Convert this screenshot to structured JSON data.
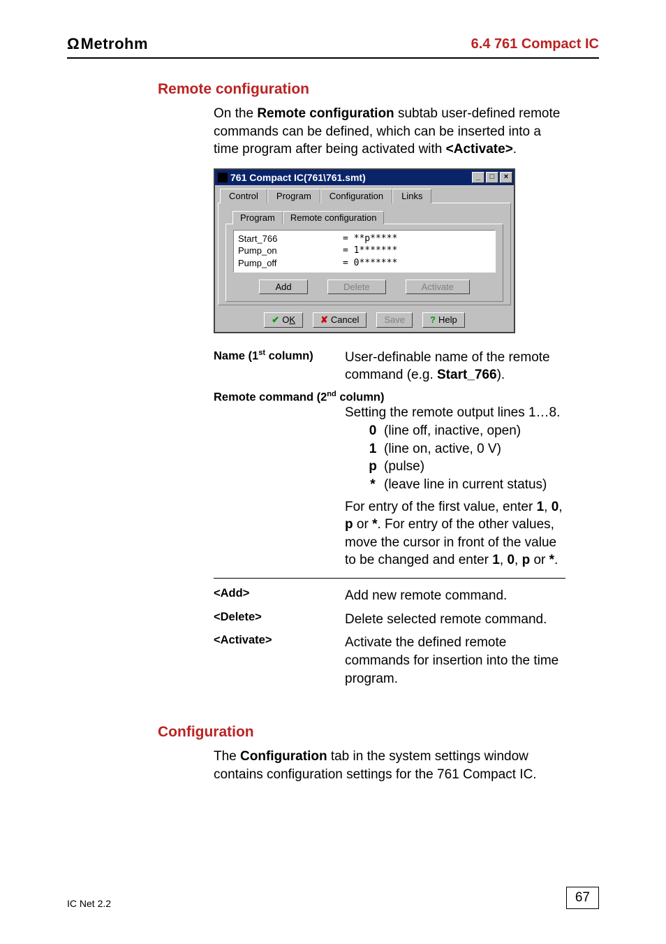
{
  "header": {
    "logo_text": "Metrohm",
    "section": "6.4  761 Compact IC"
  },
  "s1": {
    "title": "Remote configuration",
    "intro_pre": "On the ",
    "intro_bold": "Remote configuration",
    "intro_mid": " subtab user-defined remote commands can be defined, which can be inserted into a time program after being activated with ",
    "intro_activate": "<Activate>",
    "intro_end": "."
  },
  "dialog": {
    "title": "761 Compact IC(761\\761.smt)",
    "tabs": {
      "t0": "Control",
      "t1": "Program",
      "t2": "Configuration",
      "t3": "Links"
    },
    "subtabs": {
      "s0": "Program",
      "s1": "Remote configuration"
    },
    "rows": [
      {
        "name": "Start_766",
        "val": "= **p*****"
      },
      {
        "name": "Pump_on",
        "val": "= 1*******"
      },
      {
        "name": "Pump_off",
        "val": "= 0*******"
      }
    ],
    "btns": {
      "add": "Add",
      "delete": "Delete",
      "activate": "Activate"
    },
    "dlg": {
      "ok_prefix": "O",
      "ok_under": "K",
      "cancel": "Cancel",
      "save": "Save",
      "help": "Help"
    }
  },
  "defs": {
    "name_label_pre": "Name (1",
    "name_label_sup": "st",
    "name_label_post": " column)",
    "name_desc_pre": "User-definable name of the remote command (e.g. ",
    "name_desc_bold": "Start_766",
    "name_desc_post": ").",
    "rc_label_pre": "Remote command (2",
    "rc_label_sup": "nd",
    "rc_label_post": " column)",
    "rc_intro": "Setting the remote output lines 1…8.",
    "sym0": "0",
    "sym0d": "(line off, inactive, open)",
    "sym1": "1",
    "sym1d": "(line on, active, 0 V)",
    "symp": "p",
    "sympd": "(pulse)",
    "syms": "*",
    "symsd": "(leave line in current status)",
    "entry_p1a": "For entry of the first value, enter ",
    "b1": "1",
    "comma": ", ",
    "b0": "0",
    "bp": "p",
    "or": " or ",
    "bs": "*",
    "dot": ".",
    "entry_p2": "For entry of the other values, move the cursor in front of the value to be changed and enter ",
    "add_label": "<Add>",
    "add_desc": "Add new remote command.",
    "del_label": "<Delete>",
    "del_desc": "Delete selected remote command.",
    "act_label": "<Activate>",
    "act_desc": "Activate the defined remote commands for insertion into the time program."
  },
  "s2": {
    "title": "Configuration",
    "p_pre": "The ",
    "p_bold": "Configuration",
    "p_post": " tab in the system settings window contains configuration settings for the 761 Compact IC."
  },
  "footer": {
    "left": "IC Net 2.2",
    "page": "67"
  }
}
